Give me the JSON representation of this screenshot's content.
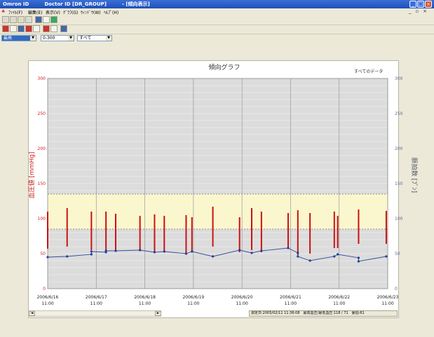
{
  "window": {
    "app_title": "Omron ID",
    "doctor": "Doctor ID [DR_GROUP]",
    "doc_title": "- [傾向表示]"
  },
  "menu": [
    "ﾌｧｲﾙ(F)",
    "編集(E)",
    "表示(V)",
    "ｸﾞﾗﾌ(G)",
    "ｳｨﾝﾄﾞｳ(W)",
    "ﾍﾙﾌﾟ(H)"
  ],
  "toolbar": {
    "select_type": "最高",
    "select_range": "0-300",
    "select_filter": "すべて"
  },
  "chart_data": {
    "type": "line",
    "title": "傾向グラフ",
    "legend_text": "すべてのデータ",
    "ylabel_left": "血圧値 [mmHg]",
    "ylabel_right": "脈拍数 [ﾌﾟﾝ]",
    "ylim_left": [
      0,
      300
    ],
    "ylim_right": [
      0,
      300
    ],
    "yticks": [
      "0",
      "50",
      "100",
      "150",
      "200",
      "250",
      "300"
    ],
    "xticks": [
      {
        "date": "2006/6/16",
        "time": "11:00"
      },
      {
        "date": "2006/6/17",
        "time": "11:00"
      },
      {
        "date": "2006/6/18",
        "time": "11:00"
      },
      {
        "date": "2006/6/19",
        "time": "11:00"
      },
      {
        "date": "2006/6/20",
        "time": "11:00"
      },
      {
        "date": "2006/6/21",
        "time": "11:00"
      },
      {
        "date": "2006/6/22",
        "time": "11:00"
      },
      {
        "date": "2006/6/23",
        "time": "11:00"
      }
    ],
    "target_band": [
      85,
      135
    ],
    "bp_series": [
      {
        "x": 0.0,
        "low": 57,
        "high": 110
      },
      {
        "x": 0.4,
        "low": 60,
        "high": 115
      },
      {
        "x": 0.9,
        "low": 55,
        "high": 110
      },
      {
        "x": 1.2,
        "low": 55,
        "high": 110
      },
      {
        "x": 1.4,
        "low": 55,
        "high": 107
      },
      {
        "x": 1.9,
        "low": 55,
        "high": 104
      },
      {
        "x": 2.2,
        "low": 52,
        "high": 106
      },
      {
        "x": 2.4,
        "low": 52,
        "high": 104
      },
      {
        "x": 2.85,
        "low": 50,
        "high": 105
      },
      {
        "x": 2.97,
        "low": 52,
        "high": 102
      },
      {
        "x": 3.4,
        "low": 60,
        "high": 117
      },
      {
        "x": 3.95,
        "low": 52,
        "high": 102
      },
      {
        "x": 4.2,
        "low": 55,
        "high": 115
      },
      {
        "x": 4.4,
        "low": 52,
        "high": 110
      },
      {
        "x": 4.95,
        "low": 58,
        "high": 108
      },
      {
        "x": 5.15,
        "low": 48,
        "high": 112
      },
      {
        "x": 5.4,
        "low": 50,
        "high": 108
      },
      {
        "x": 5.9,
        "low": 58,
        "high": 110
      },
      {
        "x": 5.97,
        "low": 58,
        "high": 104
      },
      {
        "x": 6.4,
        "low": 64,
        "high": 113
      },
      {
        "x": 6.97,
        "low": 64,
        "high": 111
      }
    ],
    "pulse_series": [
      {
        "x": 0.0,
        "y": 45
      },
      {
        "x": 0.4,
        "y": 46
      },
      {
        "x": 0.9,
        "y": 49
      },
      {
        "x": 0.9,
        "y": 53
      },
      {
        "x": 1.2,
        "y": 52
      },
      {
        "x": 1.2,
        "y": 54
      },
      {
        "x": 1.4,
        "y": 54
      },
      {
        "x": 1.9,
        "y": 55
      },
      {
        "x": 2.2,
        "y": 52
      },
      {
        "x": 2.4,
        "y": 53
      },
      {
        "x": 2.85,
        "y": 50
      },
      {
        "x": 2.97,
        "y": 53
      },
      {
        "x": 3.4,
        "y": 46
      },
      {
        "x": 3.95,
        "y": 55
      },
      {
        "x": 4.2,
        "y": 51
      },
      {
        "x": 4.4,
        "y": 54
      },
      {
        "x": 4.95,
        "y": 58
      },
      {
        "x": 5.15,
        "y": 51
      },
      {
        "x": 5.15,
        "y": 46
      },
      {
        "x": 5.4,
        "y": 40
      },
      {
        "x": 5.9,
        "y": 46
      },
      {
        "x": 5.97,
        "y": 49
      },
      {
        "x": 6.4,
        "y": 44
      },
      {
        "x": 6.4,
        "y": 39
      },
      {
        "x": 6.97,
        "y": 46
      }
    ]
  },
  "status": "測定日:2005/02/11 11:36:08　最高血圧/最低血圧:118 / 71　脈拍:61"
}
